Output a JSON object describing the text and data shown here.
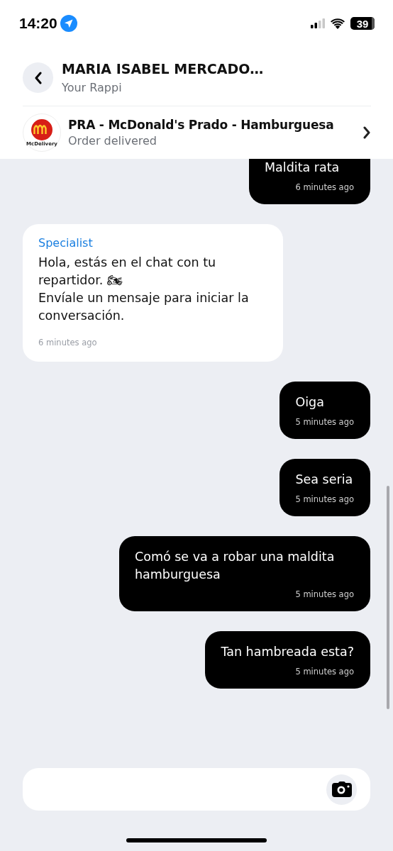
{
  "status_bar": {
    "time": "14:20",
    "battery": "39"
  },
  "header": {
    "title": "MARIA ISABEL MERCADO…",
    "subtitle": "Your Rappi"
  },
  "order": {
    "logo_text": "McDelivery",
    "title": "PRA - McDonald's Prado - Hamburguesa",
    "status": "Order delivered"
  },
  "messages": [
    {
      "kind": "outgoing",
      "text": "Maldita rata",
      "time": "6 minutes ago"
    },
    {
      "kind": "incoming",
      "sender": "Specialist",
      "text": "Hola, estás en el chat con tu repartidor. 🏍\nEnvíale un mensaje para iniciar la conversación.",
      "time": "6 minutes ago"
    },
    {
      "kind": "outgoing",
      "text": "Oiga",
      "time": "5 minutes ago"
    },
    {
      "kind": "outgoing",
      "text": "Sea seria",
      "time": "5 minutes ago"
    },
    {
      "kind": "outgoing",
      "text": "Comó se va a robar una maldita hamburguesa",
      "time": "5 minutes ago"
    },
    {
      "kind": "outgoing",
      "text": "Tan hambreada esta?",
      "time": "5 minutes ago"
    }
  ]
}
